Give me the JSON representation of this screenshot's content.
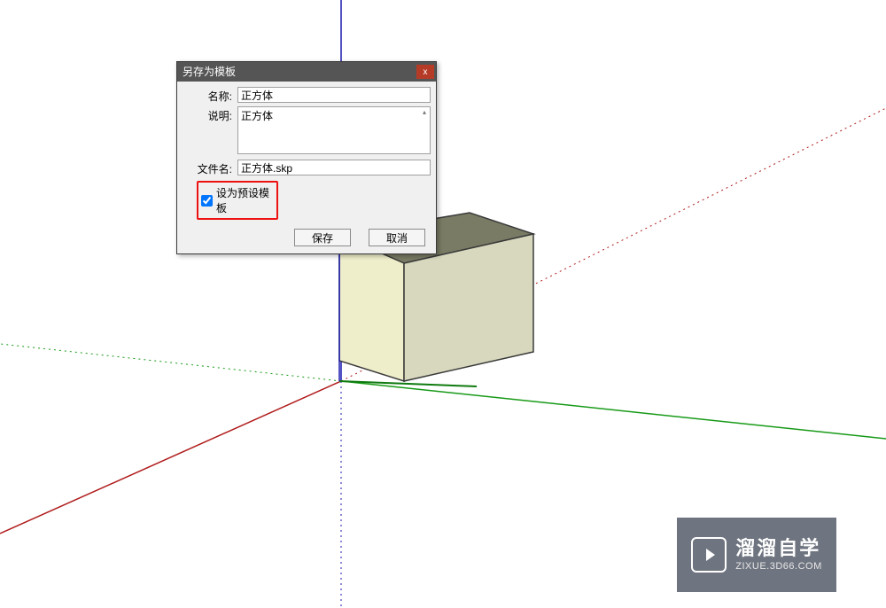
{
  "dialog": {
    "title": "另存为模板",
    "close_glyph": "x",
    "labels": {
      "name": "名称:",
      "desc": "说明:",
      "file": "文件名:"
    },
    "values": {
      "name": "正方体",
      "desc": "正方体",
      "file": "正方体.skp"
    },
    "checkbox": {
      "label": "设为预设模板",
      "checked": true
    },
    "buttons": {
      "save": "保存",
      "cancel": "取消"
    }
  },
  "watermark": {
    "main": "溜溜自学",
    "sub": "ZIXUE.3D66.COM"
  }
}
